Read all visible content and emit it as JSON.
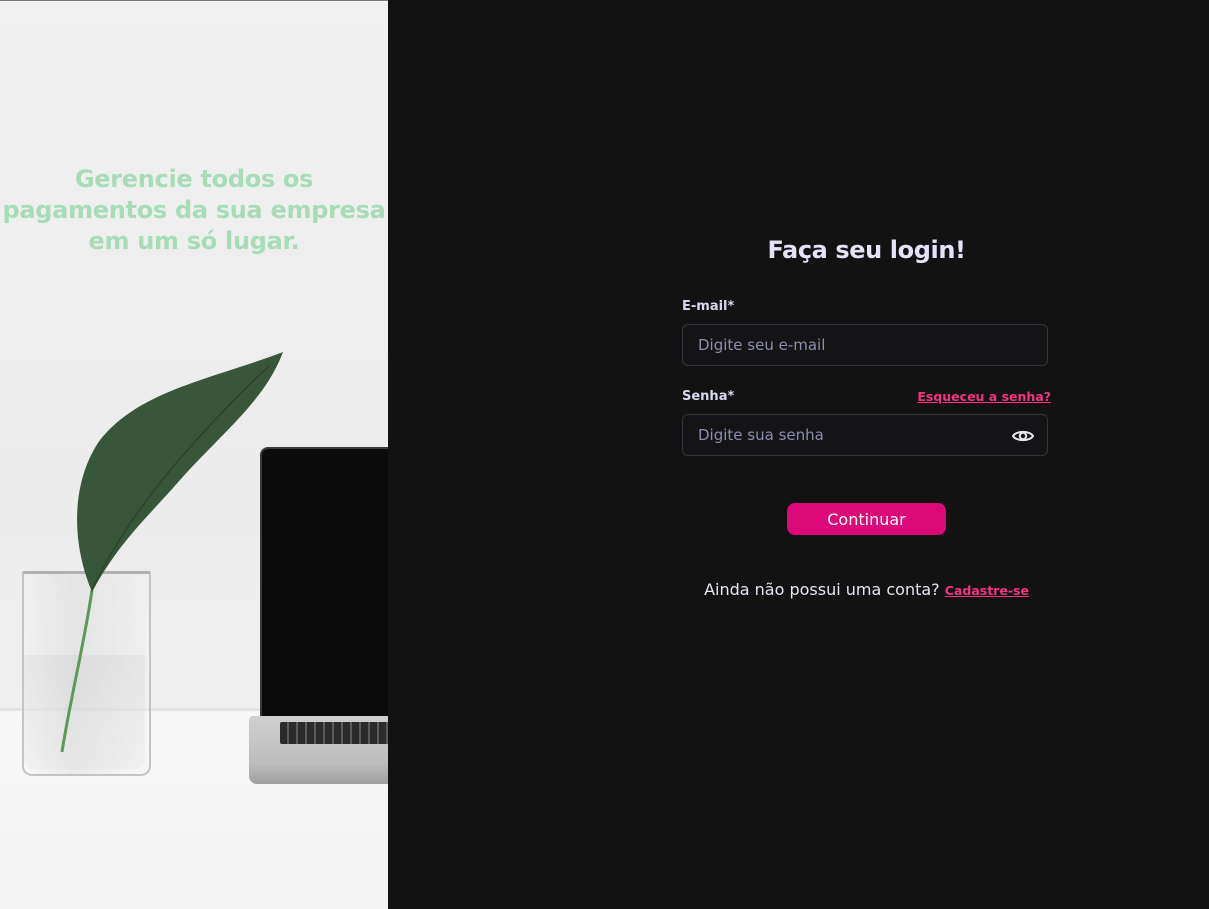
{
  "hero": {
    "tagline": "Gerencie todos os pagamentos da sua empresa em um só lugar."
  },
  "login": {
    "title": "Faça seu login!",
    "email": {
      "label": "E-mail*",
      "placeholder": "Digite seu e-mail",
      "value": ""
    },
    "password": {
      "label": "Senha*",
      "placeholder": "Digite sua senha",
      "value": "",
      "toggle_icon": "eye-icon"
    },
    "forgot_link": "Esqueceu a senha?",
    "continue_label": "Continuar",
    "signup_prompt": "Ainda não possui uma conta?",
    "signup_link": "Cadastre-se"
  },
  "colors": {
    "background": "#121212",
    "accent": "#dc0a79",
    "link": "#f0357f",
    "tagline": "#a6dcb6",
    "heading": "#e4e2f7"
  }
}
